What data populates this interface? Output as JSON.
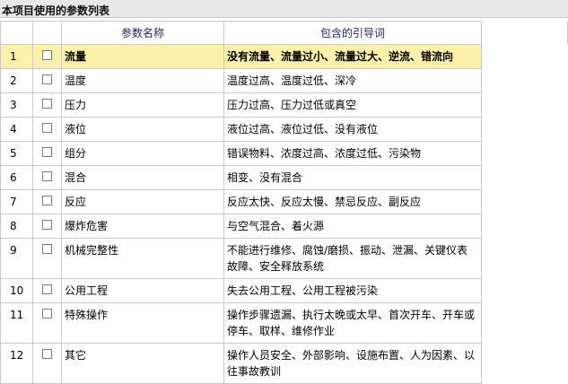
{
  "panel": {
    "title": "本项目使用的参数列表"
  },
  "table": {
    "headers": {
      "num": "",
      "check": "",
      "param_name": "参数名称",
      "guide_words": "包含的引导词"
    },
    "rows": [
      {
        "num": "1",
        "name": "流量",
        "words": "没有流量、流量过小、流量过大、逆流、错流向",
        "selected": true
      },
      {
        "num": "2",
        "name": "温度",
        "words": "温度过高、温度过低、深冷"
      },
      {
        "num": "3",
        "name": "压力",
        "words": "压力过高、压力过低或真空"
      },
      {
        "num": "4",
        "name": "液位",
        "words": "液位过高、液位过低、没有液位"
      },
      {
        "num": "5",
        "name": "组分",
        "words": "错误物料、浓度过高、浓度过低、污染物"
      },
      {
        "num": "6",
        "name": "混合",
        "words": "相变、没有混合"
      },
      {
        "num": "7",
        "name": "反应",
        "words": "反应太快、反应太慢、禁忌反应、副反应"
      },
      {
        "num": "8",
        "name": "爆炸危害",
        "words": "与空气混合、着火源"
      },
      {
        "num": "9",
        "name": "机械完整性",
        "words": "不能进行维修、腐蚀/磨损、振动、泄漏、关键仪表故障、安全释放系统"
      },
      {
        "num": "10",
        "name": "公用工程",
        "words": "失去公用工程、公用工程被污染"
      },
      {
        "num": "11",
        "name": "特殊操作",
        "words": "操作步骤遗漏、执行太晚或太早、首次开车、开车或停车、取样、维修作业"
      },
      {
        "num": "12",
        "name": "其它",
        "words": "操作人员安全、外部影响、设施布置、人为因素、以往事故教训"
      }
    ]
  },
  "colors": {
    "selected_row_bg": "#fcf1a8",
    "header_text": "#1a1f6e",
    "title_bar_bg": "#e8e8e8"
  }
}
